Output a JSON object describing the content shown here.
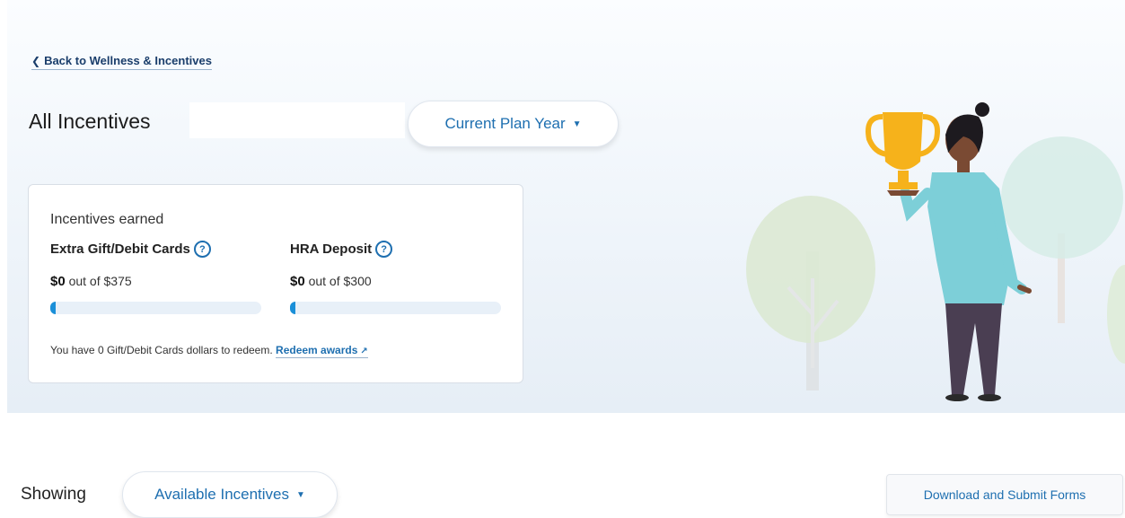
{
  "nav": {
    "back_chevron": "❮",
    "back_label": "Back to Wellness & Incentives"
  },
  "header": {
    "title": "All Incentives",
    "plan_year_filter": {
      "label": "Current Plan Year",
      "caret": "▼"
    }
  },
  "incentives_card": {
    "heading": "Incentives earned",
    "items": [
      {
        "title": "Extra Gift/Debit Cards",
        "earned": "$0",
        "separator": "out of",
        "total": "$375",
        "progress": 0
      },
      {
        "title": "HRA Deposit",
        "earned": "$0",
        "separator": "out of",
        "total": "$300",
        "progress": 0
      }
    ],
    "help_icon_glyph": "?",
    "redeem_text": "You have 0 Gift/Debit Cards dollars to redeem.",
    "redeem_link": "Redeem awards",
    "external_icon_glyph": "↗"
  },
  "showing": {
    "label": "Showing",
    "filter": {
      "label": "Available Incentives",
      "caret": "▼"
    }
  },
  "actions": {
    "download_forms": "Download and Submit Forms"
  },
  "colors": {
    "accent": "#1e6fb0",
    "progress_fill": "#1a8fd8",
    "progress_track": "#e8f0f8"
  },
  "icons": [
    "chevron-left-icon",
    "chevron-down-icon",
    "question-circle-icon",
    "external-link-icon"
  ]
}
